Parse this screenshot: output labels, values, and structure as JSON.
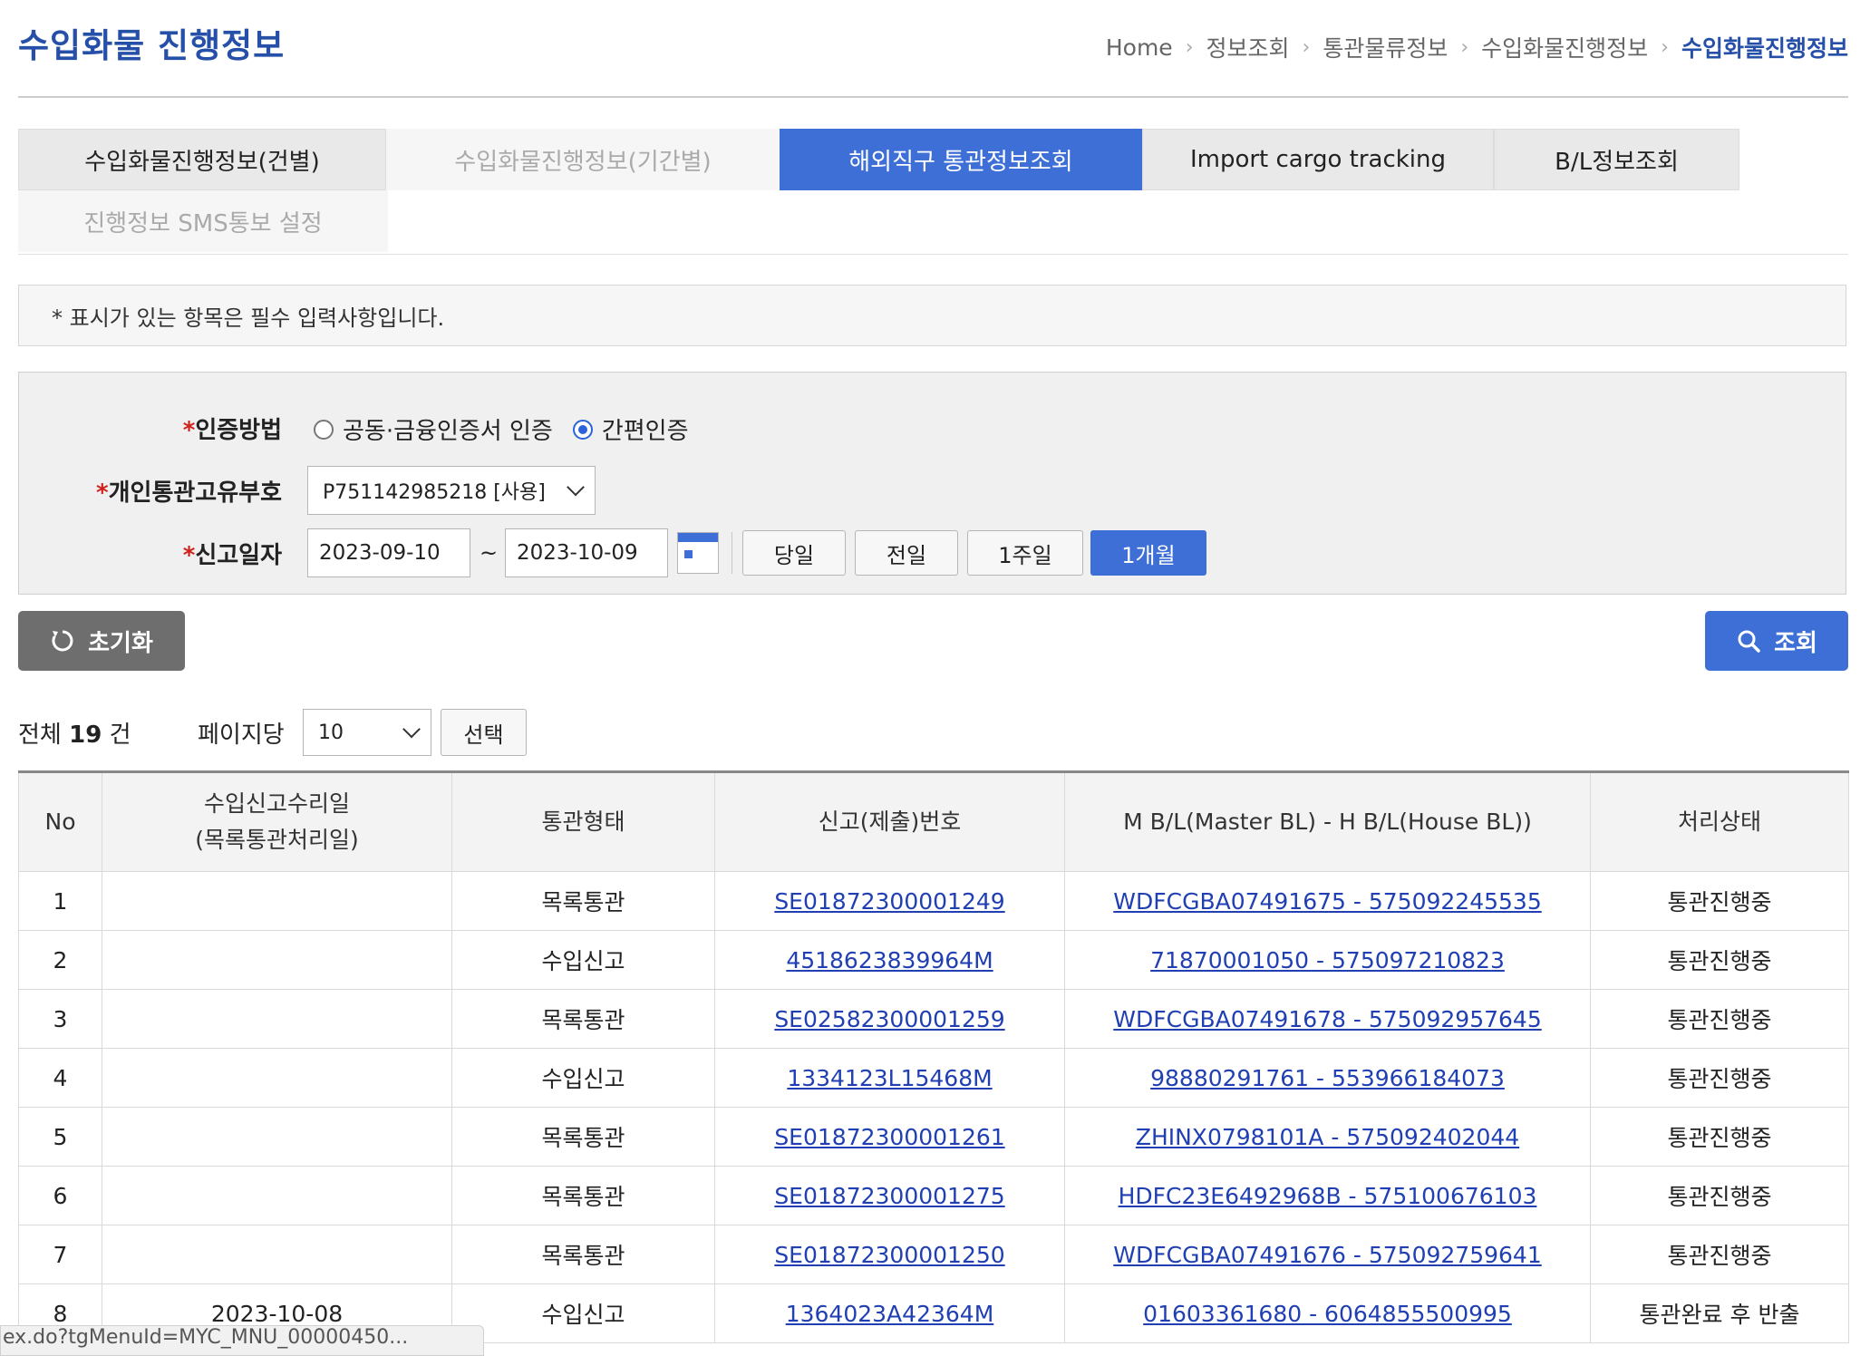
{
  "page": {
    "title": "수입화물 진행정보"
  },
  "breadcrumb": [
    "Home",
    "정보조회",
    "통관물류정보",
    "수입화물진행정보",
    "수입화물진행정보"
  ],
  "tabs": [
    {
      "label": "수입화물진행정보(건별)",
      "state": "normal"
    },
    {
      "label": "수입화물진행정보(기간별)",
      "state": "disabled"
    },
    {
      "label": "해외직구 통관정보조회",
      "state": "active"
    },
    {
      "label": "Import cargo tracking",
      "state": "normal"
    },
    {
      "label": "B/L정보조회",
      "state": "normal"
    },
    {
      "label": "진행정보 SMS통보 설정",
      "state": "disabled"
    }
  ],
  "notice": "* 표시가 있는 항목은 필수 입력사항입니다.",
  "form": {
    "required_mark": "*",
    "auth_method_label": "인증방법",
    "auth_options": [
      "공동·금융인증서 인증",
      "간편인증"
    ],
    "auth_selected": "간편인증",
    "customs_code_label": "개인통관고유부호",
    "customs_code_value": "P751142985218 [사용]",
    "date_label": "신고일자",
    "date_from": "2023-09-10",
    "date_sep": "~",
    "date_to": "2023-10-09",
    "period_buttons": [
      "당일",
      "전일",
      "1주일",
      "1개월"
    ],
    "period_selected": "1개월"
  },
  "actions": {
    "reset_label": "초기화",
    "search_label": "조회"
  },
  "list": {
    "total_prefix": "전체",
    "total_count": "19",
    "total_suffix": "건",
    "per_page_label": "페이지당",
    "per_page_value": "10",
    "select_label": "선택"
  },
  "table": {
    "headers": {
      "no": "No",
      "date_line1": "수입신고수리일",
      "date_line2": "(목록통관처리일)",
      "type": "통관형태",
      "decl_no": "신고(제출)번호",
      "bl": "M B/L(Master BL) - H B/L(House BL))",
      "status": "처리상태"
    },
    "rows": [
      {
        "no": "1",
        "date": "",
        "type": "목록통관",
        "decl": "SE01872300001249",
        "bl": "WDFCGBA07491675 - 575092245535",
        "status": "통관진행중"
      },
      {
        "no": "2",
        "date": "",
        "type": "수입신고",
        "decl": "4518623839964M",
        "bl": "71870001050 - 575097210823",
        "status": "통관진행중"
      },
      {
        "no": "3",
        "date": "",
        "type": "목록통관",
        "decl": "SE02582300001259",
        "bl": "WDFCGBA07491678 - 575092957645",
        "status": "통관진행중"
      },
      {
        "no": "4",
        "date": "",
        "type": "수입신고",
        "decl": "1334123L15468M",
        "bl": "98880291761 - 553966184073",
        "status": "통관진행중"
      },
      {
        "no": "5",
        "date": "",
        "type": "목록통관",
        "decl": "SE01872300001261",
        "bl": "ZHINX0798101A - 575092402044",
        "status": "통관진행중"
      },
      {
        "no": "6",
        "date": "",
        "type": "목록통관",
        "decl": "SE01872300001275",
        "bl": "HDFC23E6492968B - 575100676103",
        "status": "통관진행중"
      },
      {
        "no": "7",
        "date": "",
        "type": "목록통관",
        "decl": "SE01872300001250",
        "bl": "WDFCGBA07491676 - 575092759641",
        "status": "통관진행중"
      },
      {
        "no": "8",
        "date": "2023-10-08",
        "type": "수입신고",
        "decl": "1364023A42364M",
        "bl": "01603361680 - 6064855500995",
        "status": "통관완료 후 반출"
      }
    ]
  },
  "statusbar": {
    "text": "ex.do?tgMenuId=MYC_MNU_00000450..."
  },
  "colors": {
    "primary": "#3d6fd6",
    "title": "#2650a8",
    "link": "#1f3fb3",
    "required": "#d0211c"
  }
}
